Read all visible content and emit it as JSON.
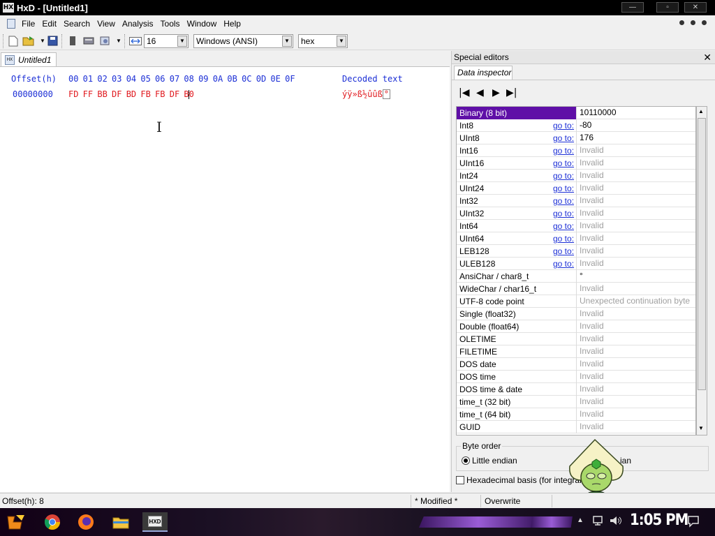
{
  "window": {
    "title": "HxD - [Untitled1]"
  },
  "menu": [
    "File",
    "Edit",
    "Search",
    "View",
    "Analysis",
    "Tools",
    "Window",
    "Help"
  ],
  "toolbar": {
    "bytes_per_row": "16",
    "charset": "Windows (ANSI)",
    "offset_base": "hex"
  },
  "tab": {
    "label": "Untitled1"
  },
  "hex": {
    "header_offset": "Offset(h)",
    "header_columns": "00 01 02 03 04 05 06 07 08 09 0A 0B 0C 0D 0E 0F",
    "header_decoded": "Decoded text",
    "row_offset": "00000000",
    "row_bytes": "FD FF BB DF BD FB FB DF B",
    "row_cursor_byte": "0",
    "row_decoded": "ýÿ»ß½ûûß",
    "row_decoded_sel": "°"
  },
  "special": {
    "title": "Special editors",
    "close": "✕",
    "tab_label": "Data inspector",
    "rows": [
      {
        "name": "Binary (8 bit)",
        "goto": "",
        "value": "10110000",
        "invalid": false,
        "selected": true
      },
      {
        "name": "Int8",
        "goto": "go to:",
        "value": "-80",
        "invalid": false
      },
      {
        "name": "UInt8",
        "goto": "go to:",
        "value": "176",
        "invalid": false
      },
      {
        "name": "Int16",
        "goto": "go to:",
        "value": "Invalid",
        "invalid": true
      },
      {
        "name": "UInt16",
        "goto": "go to:",
        "value": "Invalid",
        "invalid": true
      },
      {
        "name": "Int24",
        "goto": "go to:",
        "value": "Invalid",
        "invalid": true
      },
      {
        "name": "UInt24",
        "goto": "go to:",
        "value": "Invalid",
        "invalid": true
      },
      {
        "name": "Int32",
        "goto": "go to:",
        "value": "Invalid",
        "invalid": true
      },
      {
        "name": "UInt32",
        "goto": "go to:",
        "value": "Invalid",
        "invalid": true
      },
      {
        "name": "Int64",
        "goto": "go to:",
        "value": "Invalid",
        "invalid": true
      },
      {
        "name": "UInt64",
        "goto": "go to:",
        "value": "Invalid",
        "invalid": true
      },
      {
        "name": "LEB128",
        "goto": "go to:",
        "value": "Invalid",
        "invalid": true
      },
      {
        "name": "ULEB128",
        "goto": "go to:",
        "value": "Invalid",
        "invalid": true
      },
      {
        "name": "AnsiChar / char8_t",
        "goto": "",
        "value": "°",
        "invalid": false
      },
      {
        "name": "WideChar / char16_t",
        "goto": "",
        "value": "Invalid",
        "invalid": true
      },
      {
        "name": "UTF-8 code point",
        "goto": "",
        "value": "Unexpected continuation byte",
        "invalid": true
      },
      {
        "name": "Single (float32)",
        "goto": "",
        "value": "Invalid",
        "invalid": true
      },
      {
        "name": "Double (float64)",
        "goto": "",
        "value": "Invalid",
        "invalid": true
      },
      {
        "name": "OLETIME",
        "goto": "",
        "value": "Invalid",
        "invalid": true
      },
      {
        "name": "FILETIME",
        "goto": "",
        "value": "Invalid",
        "invalid": true
      },
      {
        "name": "DOS date",
        "goto": "",
        "value": "Invalid",
        "invalid": true
      },
      {
        "name": "DOS time",
        "goto": "",
        "value": "Invalid",
        "invalid": true
      },
      {
        "name": "DOS time & date",
        "goto": "",
        "value": "Invalid",
        "invalid": true
      },
      {
        "name": "time_t (32 bit)",
        "goto": "",
        "value": "Invalid",
        "invalid": true
      },
      {
        "name": "time_t (64 bit)",
        "goto": "",
        "value": "Invalid",
        "invalid": true
      },
      {
        "name": "GUID",
        "goto": "",
        "value": "Invalid",
        "invalid": true
      }
    ],
    "byte_order_label": "Byte order",
    "little_endian": "Little endian",
    "big_endian_partial": "ian",
    "hex_basis": "Hexadecimal basis (for integral nu"
  },
  "status": {
    "offset": "Offset(h): 8",
    "modified": "* Modified *",
    "mode": "Overwrite"
  },
  "taskbar": {
    "clock": "1:05 PM"
  },
  "colors": {
    "selected_row": "#5f0fa7",
    "hex_header": "#1c2fd6",
    "hex_bytes": "#e0191e"
  }
}
